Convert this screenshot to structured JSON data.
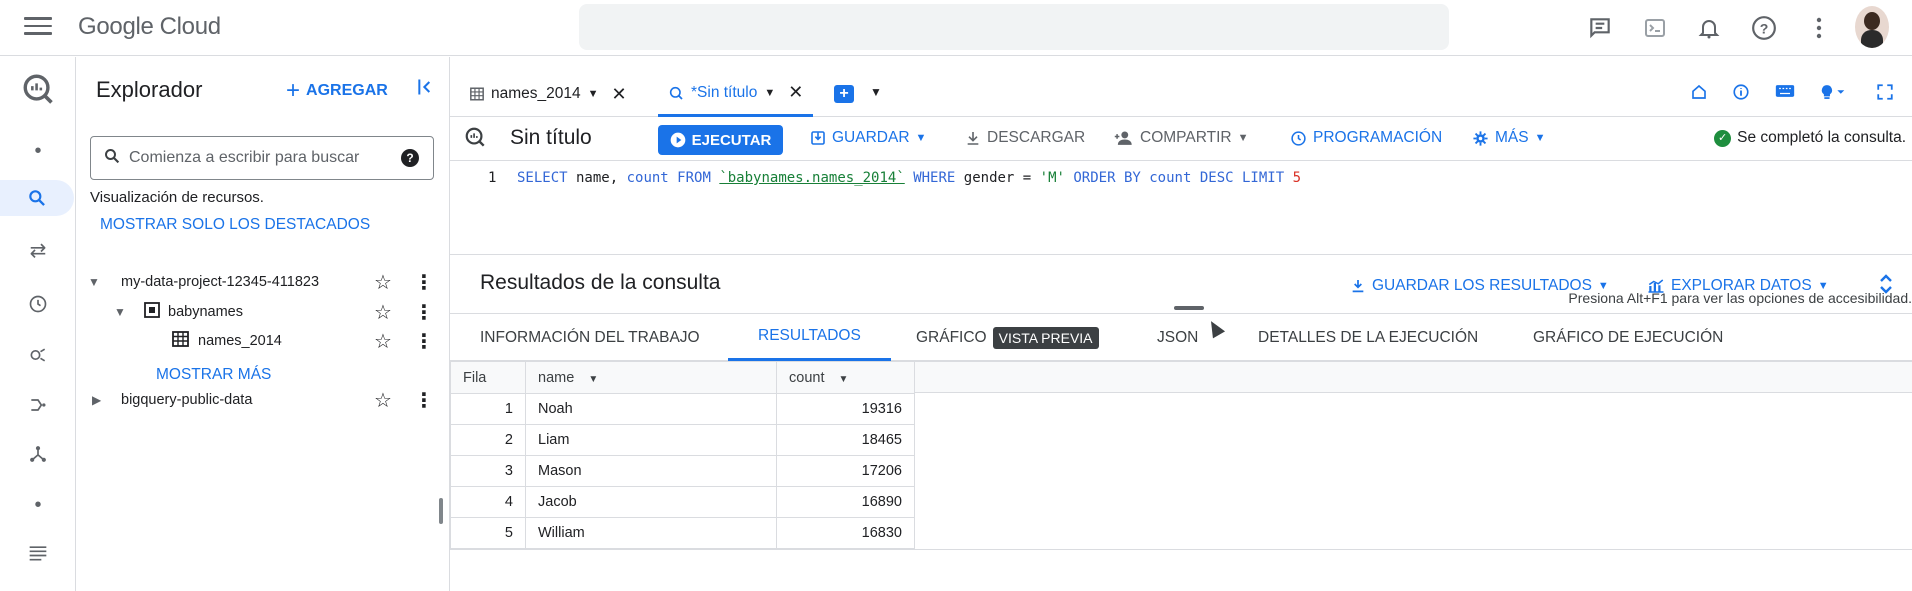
{
  "brand": {
    "google": "Google",
    "cloud": "Cloud"
  },
  "topbar": {
    "icons": [
      "hamburger-icon",
      "announcement-icon",
      "cloud-shell-icon",
      "notifications-icon",
      "help-icon",
      "more-vert-icon",
      "avatar"
    ]
  },
  "explorer": {
    "title": "Explorador",
    "add_label": "AGREGAR",
    "search_placeholder": "Comienza a escribir para buscar",
    "resources_label": "Visualización de recursos.",
    "show_starred": "MOSTRAR SOLO LOS DESTACADOS",
    "tree": [
      {
        "label": "my-data-project-12345-411823",
        "level": 0,
        "expanded": true
      },
      {
        "label": "babynames",
        "level": 1,
        "expanded": true
      },
      {
        "label": "names_2014",
        "level": 2
      },
      {
        "label": "bigquery-public-data",
        "level": 0,
        "expanded": false
      }
    ],
    "show_more": "MOSTRAR MÁS"
  },
  "tabs": [
    {
      "label": "names_2014",
      "active": false
    },
    {
      "label": "*Sin título",
      "active": true
    }
  ],
  "toolbar": {
    "title": "Sin título",
    "run": "EJECUTAR",
    "save": "GUARDAR",
    "download": "DESCARGAR",
    "share": "COMPARTIR",
    "schedule": "PROGRAMACIÓN",
    "more": "MÁS",
    "status": "Se completó la consulta."
  },
  "editor": {
    "line": "1",
    "sql_select": "SELECT",
    "sql_cols1": " name, ",
    "sql_count": "count",
    "sql_from": " FROM ",
    "sql_table": "`babynames.names_2014`",
    "sql_where": " WHERE ",
    "sql_gender": "gender",
    "sql_eq": " = ",
    "sql_val": "'M'",
    "sql_order": " ORDER BY ",
    "sql_count2": "count",
    "sql_desc": " DESC LIMIT ",
    "sql_limit": "5",
    "a11y_hint": "Presiona Alt+F1 para ver las opciones de accesibilidad."
  },
  "results": {
    "title": "Resultados de la consulta",
    "save_results": "GUARDAR LOS RESULTADOS",
    "explore": "EXPLORAR DATOS",
    "tabs": [
      "INFORMACIÓN DEL TRABAJO",
      "RESULTADOS",
      "GRÁFICO",
      "JSON",
      "DETALLES DE LA EJECUCIÓN",
      "GRÁFICO DE EJECUCIÓN"
    ],
    "preview_badge": "VISTA PREVIA",
    "columns": [
      "Fila",
      "name",
      "count"
    ],
    "rows": [
      [
        "1",
        "Noah",
        "19316"
      ],
      [
        "2",
        "Liam",
        "18465"
      ],
      [
        "3",
        "Mason",
        "17206"
      ],
      [
        "4",
        "Jacob",
        "16890"
      ],
      [
        "5",
        "William",
        "16830"
      ]
    ]
  }
}
